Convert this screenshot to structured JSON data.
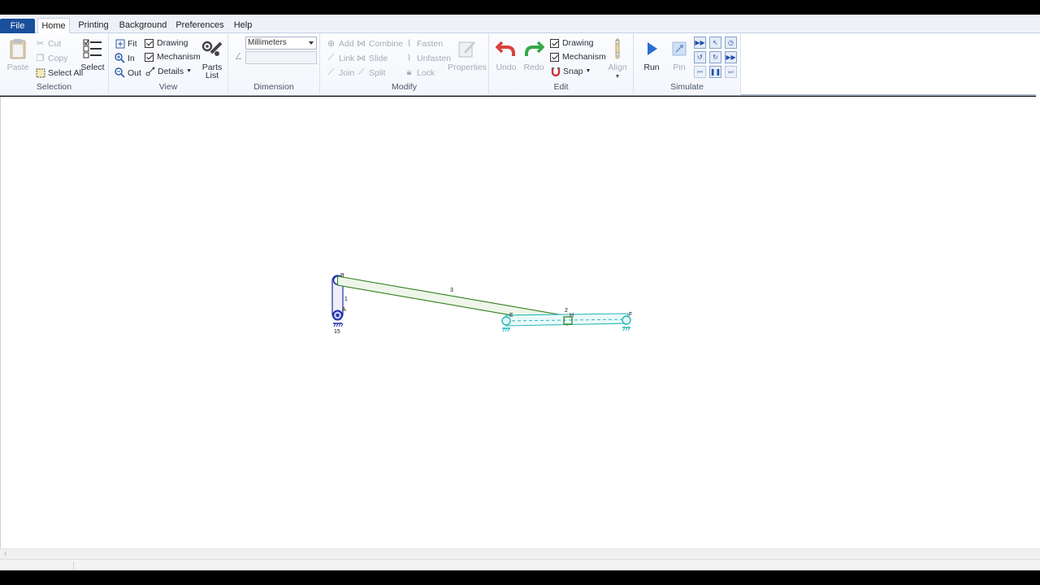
{
  "tabs": [
    "File",
    "Home",
    "Printing",
    "Background",
    "Preferences",
    "Help"
  ],
  "selection": {
    "label": "Selection",
    "paste": "Paste",
    "cut": "Cut",
    "copy": "Copy",
    "select_all": "Select All",
    "select": "Select"
  },
  "view": {
    "label": "View",
    "fit": "Fit",
    "in": "In",
    "out": "Out",
    "drawing": "Drawing",
    "mechanism": "Mechanism",
    "details": "Details",
    "parts_list_1": "Parts",
    "parts_list_2": "List"
  },
  "dimension": {
    "label": "Dimension",
    "unit": "Millimeters"
  },
  "modify": {
    "label": "Modify",
    "add": "Add",
    "link": "Link",
    "join": "Join",
    "combine": "Combine",
    "slide": "Slide",
    "split": "Split",
    "fasten": "Fasten",
    "unfasten": "Unfasten",
    "lock": "Lock",
    "properties": "Properties"
  },
  "edit": {
    "label": "Edit",
    "undo": "Undo",
    "redo": "Redo",
    "drawing": "Drawing",
    "mechanism": "Mechanism",
    "snap": "Snap",
    "align": "Align"
  },
  "simulate": {
    "label": "Simulate",
    "run": "Run",
    "pin": "Pin"
  },
  "mechanism_labels": {
    "link1": "1",
    "link2": "2",
    "link3": "3",
    "speed": "15",
    "pA": "A",
    "pB": "B",
    "pE": "E",
    "pF": "F",
    "pH": "H"
  },
  "colors": {
    "file_tab": "#1a4f9c",
    "crank": "#1f2fa8",
    "coupler": "#2f7f1f",
    "slider_link": "#2bb5b5",
    "run_blue": "#2a6fd0",
    "undo_red": "#d9413a",
    "redo_green": "#35a84a"
  }
}
